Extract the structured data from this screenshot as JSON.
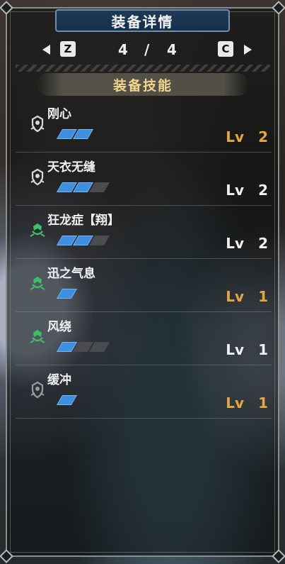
{
  "title": "装备详情",
  "pager": {
    "prev_key": "Z",
    "next_key": "C",
    "current": "4",
    "separator": "/",
    "total": "4"
  },
  "section_title": "装备技能",
  "skills": [
    {
      "name": "刚心",
      "icon": "skill-shield-icon",
      "icon_color": "#d9d9d9",
      "filled": 2,
      "max": 2,
      "lv_label": "Lv",
      "lv": "2",
      "lv_color": "orange"
    },
    {
      "name": "天衣无缝",
      "icon": "skill-shield-icon",
      "icon_color": "#d9d9d9",
      "filled": 2,
      "max": 3,
      "lv_label": "Lv",
      "lv": "2",
      "lv_color": "white"
    },
    {
      "name": "狂龙症【翔】",
      "icon": "skill-dragon-icon",
      "icon_color": "#3fbf6a",
      "filled": 2,
      "max": 3,
      "lv_label": "Lv",
      "lv": "2",
      "lv_color": "white"
    },
    {
      "name": "迅之气息",
      "icon": "skill-dragon-icon",
      "icon_color": "#3fbf6a",
      "filled": 1,
      "max": 1,
      "lv_label": "Lv",
      "lv": "1",
      "lv_color": "orange"
    },
    {
      "name": "风绕",
      "icon": "skill-dragon-icon",
      "icon_color": "#3fbf6a",
      "filled": 1,
      "max": 3,
      "lv_label": "Lv",
      "lv": "1",
      "lv_color": "white"
    },
    {
      "name": "缓冲",
      "icon": "skill-shield-icon",
      "icon_color": "#9a9a9a",
      "filled": 1,
      "max": 1,
      "lv_label": "Lv",
      "lv": "1",
      "lv_color": "orange"
    }
  ]
}
